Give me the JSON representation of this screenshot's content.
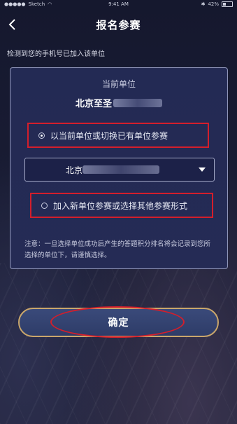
{
  "status_bar": {
    "carrier": "Sketch",
    "time": "9:41 AM",
    "battery_pct": "42%"
  },
  "nav": {
    "title": "报名参赛"
  },
  "notice": "检测到您的手机号已加入该单位",
  "card": {
    "title": "当前单位",
    "unit_name": "北京至圣",
    "option_current": "以当前单位或切换已有单位参赛",
    "select_value": "北京",
    "option_new": "加入新单位参赛或选择其他参赛形式",
    "note": "注意：一旦选择单位成功后产生的答题积分排名将会记录到您所选择的单位下，请谨慎选择。"
  },
  "confirm_label": "确定",
  "colors": {
    "highlight_red": "#d41e2b",
    "button_border": "#c9a66b",
    "card_bg": "#232a54"
  }
}
